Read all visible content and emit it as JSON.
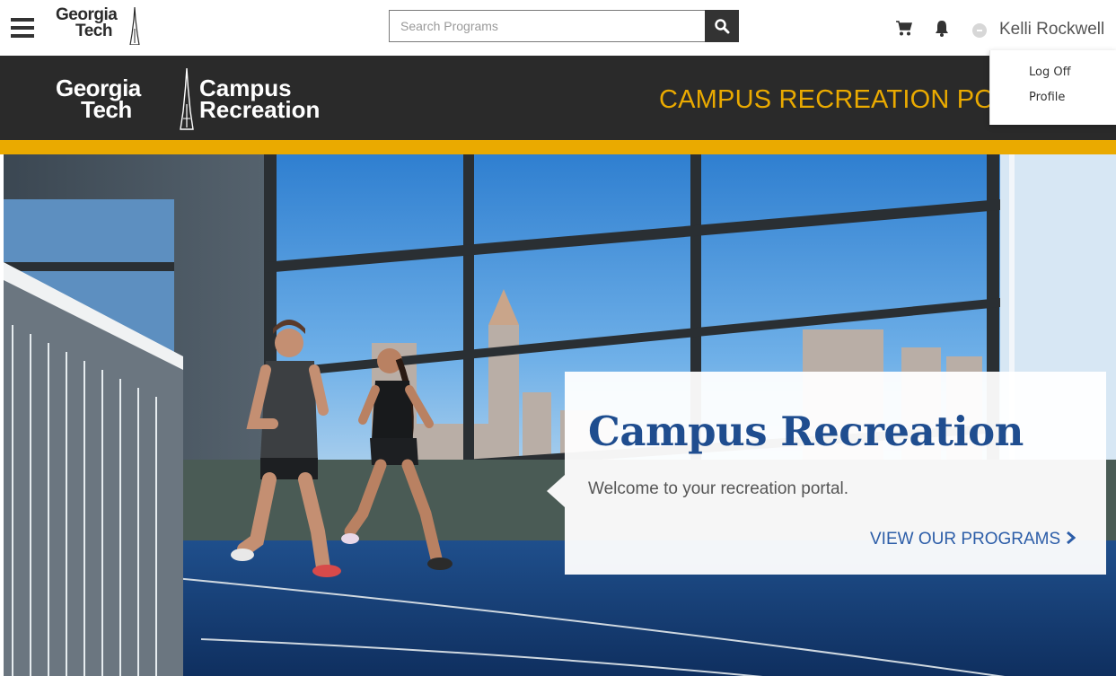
{
  "topbar": {
    "menu_icon": "hamburger-menu-icon",
    "logo": {
      "line1": "Georgia",
      "line2": "Tech"
    },
    "search": {
      "placeholder": "Search Programs",
      "value": "",
      "button_icon": "search-icon"
    },
    "cart_icon": "cart-icon",
    "notifications_icon": "bell-icon",
    "user": {
      "name": "Kelli Rockwell",
      "avatar_icon": "user-avatar-icon"
    }
  },
  "user_menu": {
    "items": [
      {
        "label": "Log Off"
      },
      {
        "label": "Profile"
      }
    ]
  },
  "brand": {
    "logo": {
      "line1": "Georgia",
      "line2": "Tech",
      "dept_line1": "Campus",
      "dept_line2": "Recreation"
    },
    "portal_title": "CAMPUS RECREATION PORTAL",
    "accent_color": "#EAAA00",
    "bar_color": "#2A2A2A"
  },
  "hero": {
    "title": "Campus Recreation",
    "subtitle": "Welcome to your recreation portal.",
    "cta_label": "VIEW OUR PROGRAMS",
    "cta_icon": "chevron-right-icon",
    "title_color": "#1F4D8F",
    "cta_color": "#2C5DA8"
  }
}
